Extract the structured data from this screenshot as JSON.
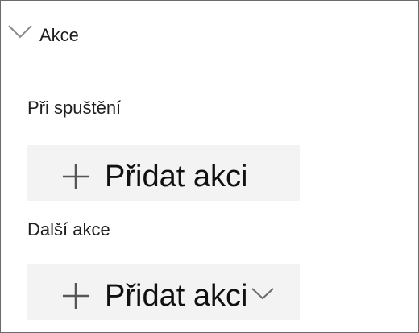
{
  "panel": {
    "header": {
      "title": "Akce",
      "chevron_icon": "chevron-down-icon"
    },
    "sections": [
      {
        "label": "Při spuštění",
        "button": {
          "label": "Přidat akci",
          "icon": "plus-icon"
        }
      },
      {
        "label": "Další akce",
        "button": {
          "label": "Přidat akci",
          "icon": "plus-icon",
          "trailing_icon": "chevron-down-icon"
        }
      }
    ]
  },
  "colors": {
    "button_bg": "#f3f3f3",
    "border": "#6b6b6b",
    "divider": "#e6e6e6",
    "text": "#1b1b1b"
  }
}
